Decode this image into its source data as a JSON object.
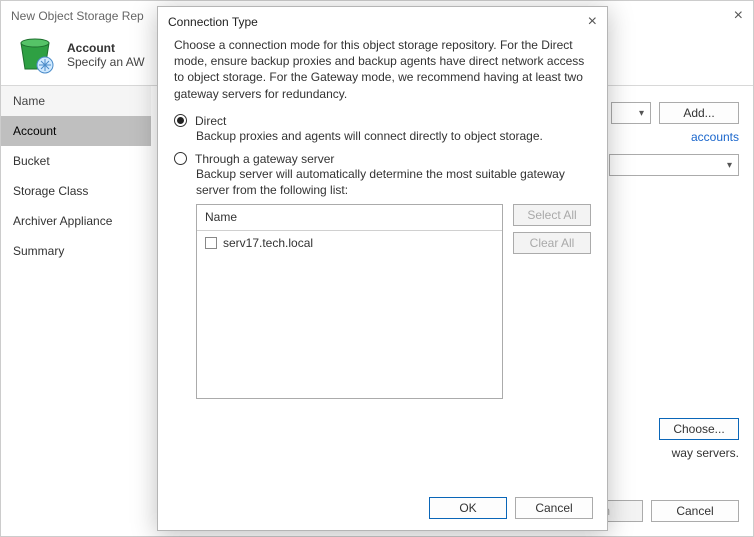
{
  "parent_window": {
    "title": "New Object Storage Rep",
    "header_title": "Account",
    "header_sub": "Specify an AW",
    "sidebar": {
      "items": [
        "Name",
        "Account",
        "Bucket",
        "Storage Class",
        "Archiver Appliance",
        "Summary"
      ],
      "selected_index": 1
    },
    "main": {
      "add_button": "Add...",
      "accounts_link": "accounts",
      "gateway_hint": "way servers.",
      "choose_button": "Choose..."
    },
    "footer": {
      "finish": "nish",
      "cancel": "Cancel"
    }
  },
  "modal": {
    "title": "Connection Type",
    "description": "Choose a connection mode for this object storage repository. For the Direct mode, ensure backup proxies and backup agents have direct network access to object storage. For the Gateway mode, we recommend having at least two gateway servers for redundancy.",
    "options": {
      "direct": {
        "label": "Direct",
        "selected": true,
        "sub": "Backup proxies and agents will connect directly to object storage."
      },
      "gateway": {
        "label": "Through a gateway server",
        "selected": false,
        "sub": "Backup server will automatically determine the most suitable gateway server from the following list:"
      }
    },
    "list": {
      "header": "Name",
      "items": [
        {
          "label": "serv17.tech.local",
          "checked": false
        }
      ]
    },
    "side_buttons": {
      "select_all": "Select All",
      "clear_all": "Clear All",
      "enabled": false
    },
    "footer": {
      "ok": "OK",
      "cancel": "Cancel"
    }
  }
}
